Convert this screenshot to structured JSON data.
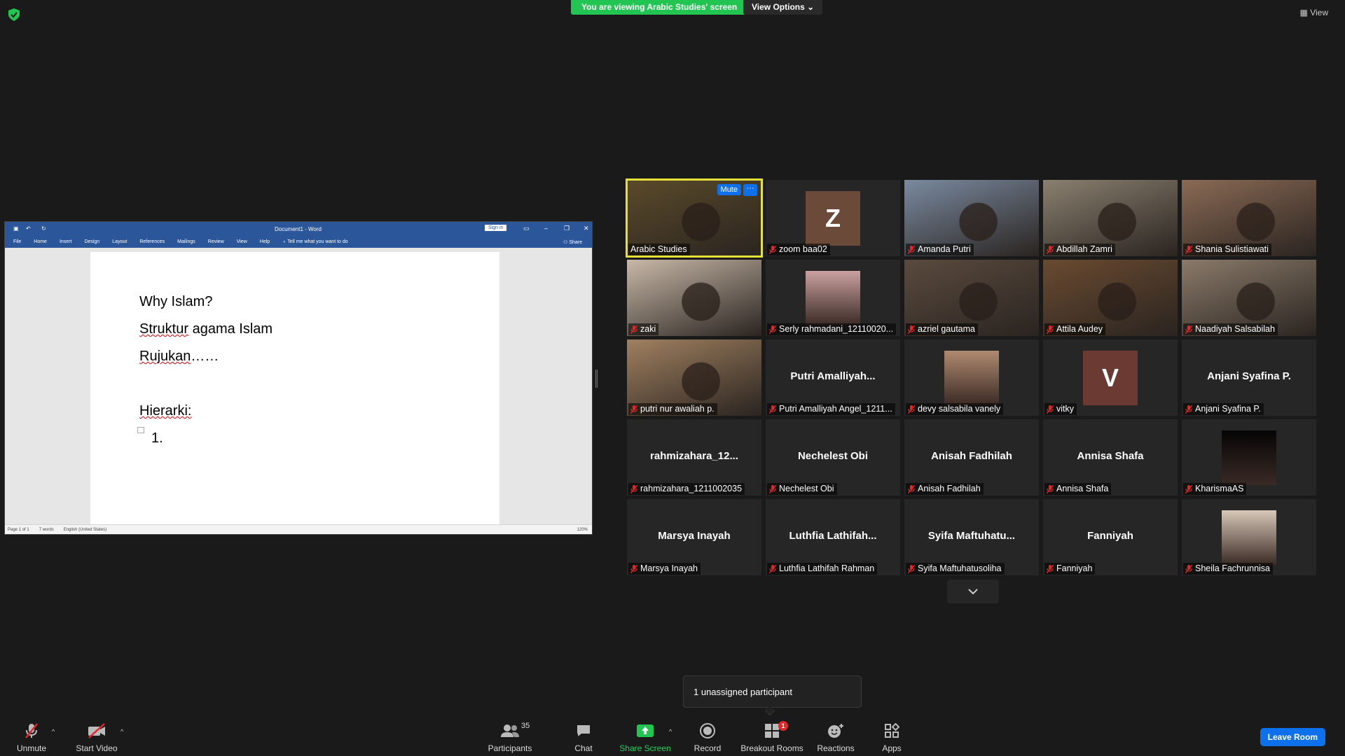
{
  "banner": {
    "viewing_text": "You are viewing Arabic Studies' screen",
    "view_options": "View Options",
    "top_view": "View"
  },
  "word": {
    "title": "Document1 - Word",
    "sign_in": "Sign in",
    "tabs": [
      "File",
      "Home",
      "Insert",
      "Design",
      "Layout",
      "References",
      "Mailings",
      "Review",
      "View",
      "Help"
    ],
    "tell_me": "Tell me what you want to do",
    "share": "Share",
    "lines": [
      "Why Islam?",
      "Struktur agama Islam",
      "Rujukan……",
      "Hierarki:",
      "1."
    ],
    "line2_rest": " agama Islam",
    "line3_rest": "……",
    "status": {
      "page": "Page 1 of 1",
      "words": "7 words",
      "lang": "English (United States)",
      "zoom": "120%"
    }
  },
  "tiles": [
    {
      "name": "Arabic Studies",
      "type": "video",
      "bg": "#5a4a2a"
    },
    {
      "name": "zoom baa02",
      "type": "avatar",
      "letter": "Z",
      "avbg": "#6b4a3a"
    },
    {
      "name": "Amanda Putri",
      "type": "video",
      "bg": "#7a8aa0"
    },
    {
      "name": "Abdillah Zamri",
      "type": "video",
      "bg": "#8a8070"
    },
    {
      "name": "Shania Sulistiawati",
      "type": "video",
      "bg": "#8a6a55"
    },
    {
      "name": "zaki",
      "type": "video",
      "bg": "#c8b8a8"
    },
    {
      "name": "Serly rahmadani_12110020...",
      "type": "photo",
      "bg": "#caa0a0"
    },
    {
      "name": "azriel gautama",
      "type": "video",
      "bg": "#5a4a3e"
    },
    {
      "name": "Attila Audey",
      "type": "video",
      "bg": "#6a4a30"
    },
    {
      "name": "Naadiyah Salsabilah",
      "type": "video",
      "bg": "#8a7a6a"
    },
    {
      "name": "putri nur awaliah p.",
      "type": "video",
      "bg": "#a08060"
    },
    {
      "name": "Putri Amalliyah Angel_1211...",
      "type": "text",
      "big": "Putri  Amalliyah..."
    },
    {
      "name": "devy salsabila vanely",
      "type": "photo",
      "bg": "#b08a70"
    },
    {
      "name": "vitky",
      "type": "avatar",
      "letter": "V",
      "avbg": "#6b3a32"
    },
    {
      "name": "Anjani Syafina P.",
      "type": "text",
      "big": "Anjani Syafina P."
    },
    {
      "name": "rahmizahara_1211002035",
      "type": "text",
      "big": "rahmizahara_12..."
    },
    {
      "name": "Nechelest Obi",
      "type": "text",
      "big": "Nechelest Obi"
    },
    {
      "name": "Anisah Fadhilah",
      "type": "text",
      "big": "Anisah Fadhilah"
    },
    {
      "name": "Annisa Shafa",
      "type": "text",
      "big": "Annisa Shafa"
    },
    {
      "name": "KharismaAS",
      "type": "photo",
      "bg": "#050505"
    },
    {
      "name": "Marsya Inayah",
      "type": "text",
      "big": "Marsya Inayah"
    },
    {
      "name": "Luthfia Lathifah Rahman",
      "type": "text",
      "big": "Luthfia  Lathifah..."
    },
    {
      "name": "Syifa Maftuhatusoliha",
      "type": "text",
      "big": "Syifa  Maftuhatu..."
    },
    {
      "name": "Fanniyah",
      "type": "text",
      "big": "Fanniyah"
    },
    {
      "name": "Sheila Fachrunnisa",
      "type": "photo",
      "bg": "#d8c8b8"
    }
  ],
  "active_controls": {
    "mute": "Mute",
    "more": "···"
  },
  "tooltip": "1 unassigned participant",
  "toolbar": {
    "unmute": "Unmute",
    "start_video": "Start Video",
    "participants": "Participants",
    "participants_count": "35",
    "chat": "Chat",
    "share_screen": "Share Screen",
    "record": "Record",
    "breakout": "Breakout Rooms",
    "breakout_badge": "1",
    "reactions": "Reactions",
    "apps": "Apps",
    "leave": "Leave Room"
  },
  "colors": {
    "accent": "#0e71eb",
    "green": "#23c552",
    "active_speaker": "#e6e03a",
    "word_blue": "#2b579a"
  }
}
